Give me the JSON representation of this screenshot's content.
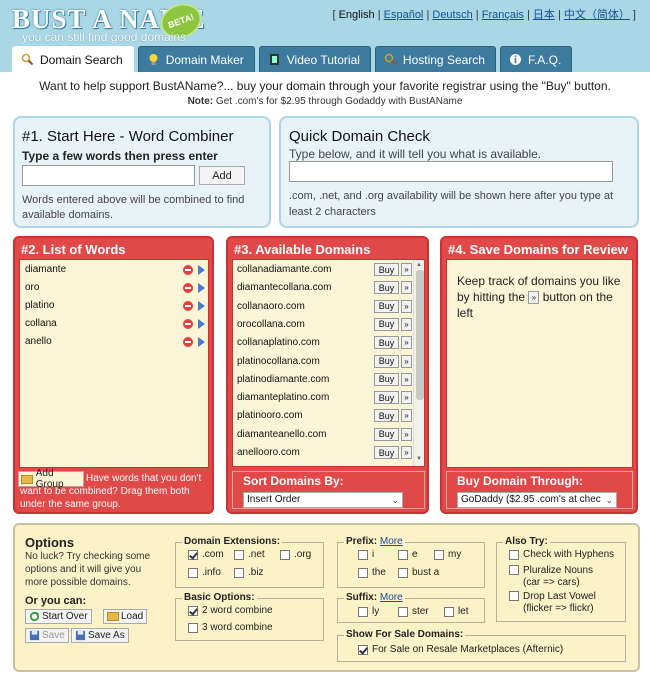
{
  "header": {
    "logo": "BUST A NAME",
    "beta": "BETA!",
    "tagline": "you can still find good domains",
    "languages": [
      "English",
      "Español",
      "Deutsch",
      "Français",
      "日本",
      "中文（简体）"
    ],
    "current_language": "English",
    "tabs": [
      {
        "label": "Domain Search",
        "icon": "magnifier-icon",
        "active": true
      },
      {
        "label": "Domain Maker",
        "icon": "lightbulb-icon",
        "active": false
      },
      {
        "label": "Video Tutorial",
        "icon": "film-icon",
        "active": false
      },
      {
        "label": "Hosting Search",
        "icon": "magnifier-icon",
        "active": false
      },
      {
        "label": "F.A.Q.",
        "icon": "info-icon",
        "active": false
      }
    ]
  },
  "support_text": "Want to help support BustAName?... buy your domain through your favorite registrar using the \"Buy\" button.",
  "note": {
    "label": "Note:",
    "text": "Get .com's for $2.95 through Godaddy with BustAName"
  },
  "combiner": {
    "title": "#1. Start Here - Word Combiner",
    "label": "Type a few words then press enter",
    "input_value": "",
    "add_label": "Add",
    "desc": "Words entered above will be combined to find available domains."
  },
  "quick_check": {
    "title": "Quick Domain Check",
    "label": "Type below, and it will tell you what is available.",
    "input_value": "",
    "desc": ".com, .net, and .org availability will be shown here after you type at least 2 characters"
  },
  "words": {
    "title": "#2. List of Words",
    "items": [
      "diamante",
      "oro",
      "platino",
      "collana",
      "anello"
    ],
    "add_group_label": "Add Group",
    "hint": "Have words that you don't want to be combined? Drag them both under the same group."
  },
  "available": {
    "title": "#3. Available Domains",
    "buy_label": "Buy",
    "save_label": "»",
    "domains": [
      "collanadiamante.com",
      "diamantecollana.com",
      "collanaoro.com",
      "orocollana.com",
      "collanaplatino.com",
      "platinocollana.com",
      "platinodiamante.com",
      "diamanteplatino.com",
      "platinooro.com",
      "diamanteanello.com",
      "anellooro.com"
    ],
    "sort_title": "Sort Domains By:",
    "sort_value": "Insert Order"
  },
  "review": {
    "title": "#4. Save Domains for Review",
    "msg_before": "Keep track of domains you like by hitting the",
    "msg_button": "»",
    "msg_after": "button on the left",
    "buy_title": "Buy Domain Through:",
    "registrar_value": "GoDaddy ($2.95 .com's at chec"
  },
  "options": {
    "title": "Options",
    "noluck": "No luck? Try checking some options and it will give you more possible domains.",
    "orcan": "Or you can:",
    "buttons": {
      "start_over": "Start Over",
      "load": "Load",
      "save": "Save",
      "save_as": "Save As"
    },
    "extensions": {
      "title": "Domain Extensions:",
      "items": [
        {
          "label": ".com",
          "checked": true
        },
        {
          "label": ".net",
          "checked": false
        },
        {
          "label": ".org",
          "checked": false
        },
        {
          "label": ".info",
          "checked": false
        },
        {
          "label": ".biz",
          "checked": false
        }
      ]
    },
    "basic": {
      "title": "Basic Options:",
      "items": [
        {
          "label": "2 word combine",
          "checked": true
        },
        {
          "label": "3 word combine",
          "checked": false
        }
      ]
    },
    "prefix": {
      "title": "Prefix:",
      "more": "More",
      "items": [
        {
          "label": "i",
          "checked": false
        },
        {
          "label": "e",
          "checked": false
        },
        {
          "label": "my",
          "checked": false
        },
        {
          "label": "the",
          "checked": false
        },
        {
          "label": "bust a",
          "checked": false
        }
      ]
    },
    "suffix": {
      "title": "Suffix:",
      "more": "More",
      "items": [
        {
          "label": "ly",
          "checked": false
        },
        {
          "label": "ster",
          "checked": false
        },
        {
          "label": "let",
          "checked": false
        }
      ]
    },
    "also_try": {
      "title": "Also Try:",
      "items": [
        {
          "label": "Check with Hyphens",
          "sub": "",
          "checked": false
        },
        {
          "label": "Pluralize Nouns",
          "sub": "(car => cars)",
          "checked": false
        },
        {
          "label": "Drop Last Vowel",
          "sub": "(flicker => flickr)",
          "checked": false
        }
      ]
    },
    "for_sale": {
      "title": "Show For Sale Domains:",
      "item": {
        "label": "For Sale on Resale Marketplaces (Afternic)",
        "checked": true
      }
    }
  }
}
